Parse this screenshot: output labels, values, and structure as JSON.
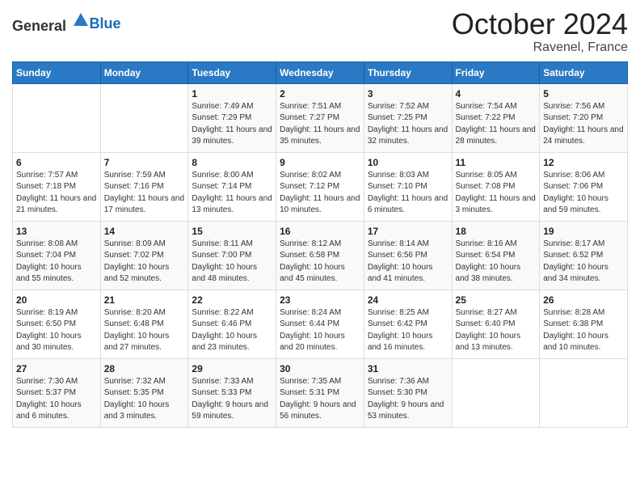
{
  "logo": {
    "general": "General",
    "blue": "Blue"
  },
  "header": {
    "month": "October 2024",
    "location": "Ravenel, France"
  },
  "days_of_week": [
    "Sunday",
    "Monday",
    "Tuesday",
    "Wednesday",
    "Thursday",
    "Friday",
    "Saturday"
  ],
  "weeks": [
    [
      {
        "day": "",
        "sunrise": "",
        "sunset": "",
        "daylight": ""
      },
      {
        "day": "",
        "sunrise": "",
        "sunset": "",
        "daylight": ""
      },
      {
        "day": "1",
        "sunrise": "Sunrise: 7:49 AM",
        "sunset": "Sunset: 7:29 PM",
        "daylight": "Daylight: 11 hours and 39 minutes."
      },
      {
        "day": "2",
        "sunrise": "Sunrise: 7:51 AM",
        "sunset": "Sunset: 7:27 PM",
        "daylight": "Daylight: 11 hours and 35 minutes."
      },
      {
        "day": "3",
        "sunrise": "Sunrise: 7:52 AM",
        "sunset": "Sunset: 7:25 PM",
        "daylight": "Daylight: 11 hours and 32 minutes."
      },
      {
        "day": "4",
        "sunrise": "Sunrise: 7:54 AM",
        "sunset": "Sunset: 7:22 PM",
        "daylight": "Daylight: 11 hours and 28 minutes."
      },
      {
        "day": "5",
        "sunrise": "Sunrise: 7:56 AM",
        "sunset": "Sunset: 7:20 PM",
        "daylight": "Daylight: 11 hours and 24 minutes."
      }
    ],
    [
      {
        "day": "6",
        "sunrise": "Sunrise: 7:57 AM",
        "sunset": "Sunset: 7:18 PM",
        "daylight": "Daylight: 11 hours and 21 minutes."
      },
      {
        "day": "7",
        "sunrise": "Sunrise: 7:59 AM",
        "sunset": "Sunset: 7:16 PM",
        "daylight": "Daylight: 11 hours and 17 minutes."
      },
      {
        "day": "8",
        "sunrise": "Sunrise: 8:00 AM",
        "sunset": "Sunset: 7:14 PM",
        "daylight": "Daylight: 11 hours and 13 minutes."
      },
      {
        "day": "9",
        "sunrise": "Sunrise: 8:02 AM",
        "sunset": "Sunset: 7:12 PM",
        "daylight": "Daylight: 11 hours and 10 minutes."
      },
      {
        "day": "10",
        "sunrise": "Sunrise: 8:03 AM",
        "sunset": "Sunset: 7:10 PM",
        "daylight": "Daylight: 11 hours and 6 minutes."
      },
      {
        "day": "11",
        "sunrise": "Sunrise: 8:05 AM",
        "sunset": "Sunset: 7:08 PM",
        "daylight": "Daylight: 11 hours and 3 minutes."
      },
      {
        "day": "12",
        "sunrise": "Sunrise: 8:06 AM",
        "sunset": "Sunset: 7:06 PM",
        "daylight": "Daylight: 10 hours and 59 minutes."
      }
    ],
    [
      {
        "day": "13",
        "sunrise": "Sunrise: 8:08 AM",
        "sunset": "Sunset: 7:04 PM",
        "daylight": "Daylight: 10 hours and 55 minutes."
      },
      {
        "day": "14",
        "sunrise": "Sunrise: 8:09 AM",
        "sunset": "Sunset: 7:02 PM",
        "daylight": "Daylight: 10 hours and 52 minutes."
      },
      {
        "day": "15",
        "sunrise": "Sunrise: 8:11 AM",
        "sunset": "Sunset: 7:00 PM",
        "daylight": "Daylight: 10 hours and 48 minutes."
      },
      {
        "day": "16",
        "sunrise": "Sunrise: 8:12 AM",
        "sunset": "Sunset: 6:58 PM",
        "daylight": "Daylight: 10 hours and 45 minutes."
      },
      {
        "day": "17",
        "sunrise": "Sunrise: 8:14 AM",
        "sunset": "Sunset: 6:56 PM",
        "daylight": "Daylight: 10 hours and 41 minutes."
      },
      {
        "day": "18",
        "sunrise": "Sunrise: 8:16 AM",
        "sunset": "Sunset: 6:54 PM",
        "daylight": "Daylight: 10 hours and 38 minutes."
      },
      {
        "day": "19",
        "sunrise": "Sunrise: 8:17 AM",
        "sunset": "Sunset: 6:52 PM",
        "daylight": "Daylight: 10 hours and 34 minutes."
      }
    ],
    [
      {
        "day": "20",
        "sunrise": "Sunrise: 8:19 AM",
        "sunset": "Sunset: 6:50 PM",
        "daylight": "Daylight: 10 hours and 30 minutes."
      },
      {
        "day": "21",
        "sunrise": "Sunrise: 8:20 AM",
        "sunset": "Sunset: 6:48 PM",
        "daylight": "Daylight: 10 hours and 27 minutes."
      },
      {
        "day": "22",
        "sunrise": "Sunrise: 8:22 AM",
        "sunset": "Sunset: 6:46 PM",
        "daylight": "Daylight: 10 hours and 23 minutes."
      },
      {
        "day": "23",
        "sunrise": "Sunrise: 8:24 AM",
        "sunset": "Sunset: 6:44 PM",
        "daylight": "Daylight: 10 hours and 20 minutes."
      },
      {
        "day": "24",
        "sunrise": "Sunrise: 8:25 AM",
        "sunset": "Sunset: 6:42 PM",
        "daylight": "Daylight: 10 hours and 16 minutes."
      },
      {
        "day": "25",
        "sunrise": "Sunrise: 8:27 AM",
        "sunset": "Sunset: 6:40 PM",
        "daylight": "Daylight: 10 hours and 13 minutes."
      },
      {
        "day": "26",
        "sunrise": "Sunrise: 8:28 AM",
        "sunset": "Sunset: 6:38 PM",
        "daylight": "Daylight: 10 hours and 10 minutes."
      }
    ],
    [
      {
        "day": "27",
        "sunrise": "Sunrise: 7:30 AM",
        "sunset": "Sunset: 5:37 PM",
        "daylight": "Daylight: 10 hours and 6 minutes."
      },
      {
        "day": "28",
        "sunrise": "Sunrise: 7:32 AM",
        "sunset": "Sunset: 5:35 PM",
        "daylight": "Daylight: 10 hours and 3 minutes."
      },
      {
        "day": "29",
        "sunrise": "Sunrise: 7:33 AM",
        "sunset": "Sunset: 5:33 PM",
        "daylight": "Daylight: 9 hours and 59 minutes."
      },
      {
        "day": "30",
        "sunrise": "Sunrise: 7:35 AM",
        "sunset": "Sunset: 5:31 PM",
        "daylight": "Daylight: 9 hours and 56 minutes."
      },
      {
        "day": "31",
        "sunrise": "Sunrise: 7:36 AM",
        "sunset": "Sunset: 5:30 PM",
        "daylight": "Daylight: 9 hours and 53 minutes."
      },
      {
        "day": "",
        "sunrise": "",
        "sunset": "",
        "daylight": ""
      },
      {
        "day": "",
        "sunrise": "",
        "sunset": "",
        "daylight": ""
      }
    ]
  ]
}
